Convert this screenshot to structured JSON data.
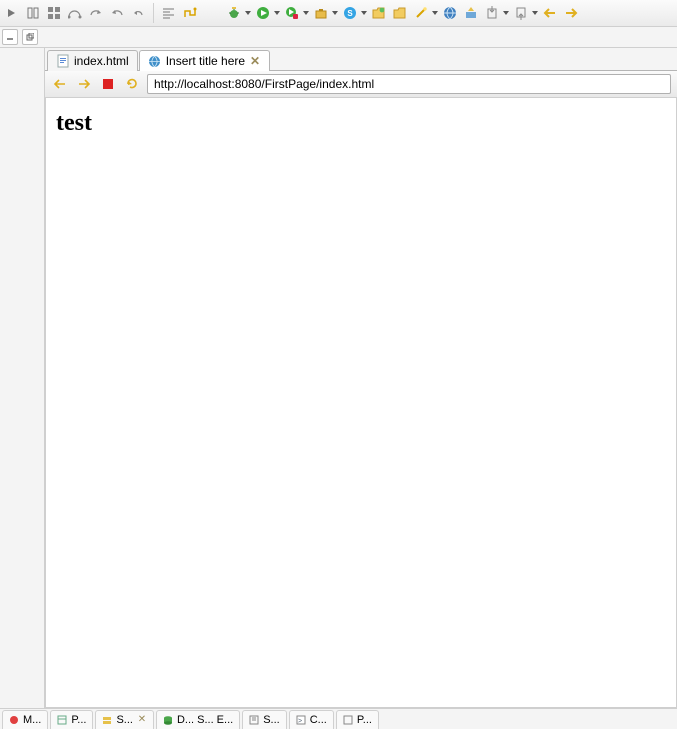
{
  "toolbar": {
    "icons": [
      "arrow-right-icon",
      "columns-icon",
      "boxes-icon",
      "flow-icon",
      "redo-icon",
      "undo-stack-icon",
      "undo-small-icon"
    ]
  },
  "tabs": [
    {
      "icon": "file-html-icon",
      "label": "index.html",
      "active": false
    },
    {
      "icon": "globe-icon",
      "label": "Insert title here",
      "active": true
    }
  ],
  "nav": {
    "url": "http://localhost:8080/FirstPage/index.html"
  },
  "page": {
    "heading": "test"
  },
  "bottom_views": [
    {
      "icon": "marker-red",
      "label": "M..."
    },
    {
      "icon": "panel",
      "label": "P..."
    },
    {
      "icon": "server-yellow",
      "label": "S...",
      "closable": true
    },
    {
      "icon": "db-green",
      "label": "D... S... E..."
    },
    {
      "icon": "snippet",
      "label": "S..."
    },
    {
      "icon": "console",
      "label": "C..."
    },
    {
      "icon": "panel",
      "label": "P..."
    }
  ]
}
